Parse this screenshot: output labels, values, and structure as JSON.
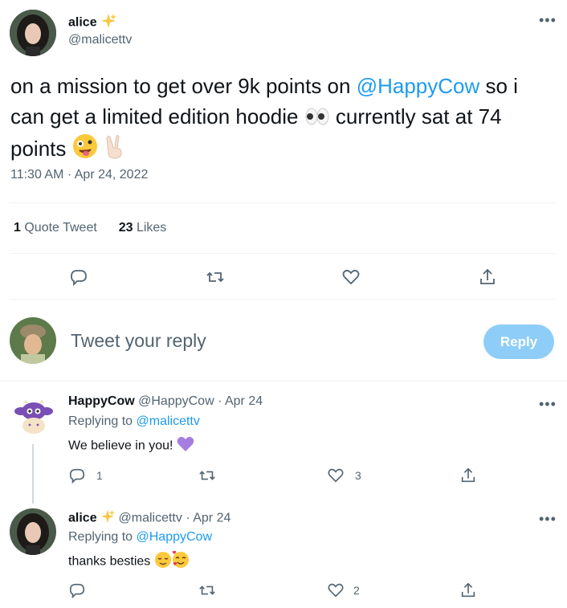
{
  "main_tweet": {
    "display_name": "alice",
    "handle": "@malicettv",
    "text_before": "on a mission to get over 9k points on ",
    "mention": "@HappyCow",
    "text_mid": " so i can get a limited edition hoodie ",
    "text_after": " currently sat at 74 points ",
    "timestamp": "11:30 AM · Apr 24, 2022",
    "quote_count": "1",
    "quote_label": "Quote Tweet",
    "like_count": "23",
    "like_label": "Likes"
  },
  "reply_box": {
    "placeholder": "Tweet your reply",
    "button_label": "Reply"
  },
  "replies": [
    {
      "display_name": "HappyCow",
      "handle": "@HappyCow",
      "date": "· Apr 24",
      "replying_prefix": "Replying to ",
      "replying_to": "@malicettv",
      "text": "We believe in you! ",
      "reply_count": "1",
      "like_count": "3"
    },
    {
      "display_name": "alice",
      "handle": "@malicettv",
      "date": "· Apr 24",
      "replying_prefix": "Replying to ",
      "replying_to": "@HappyCow",
      "text": "thanks besties ",
      "reply_count": "",
      "like_count": "2"
    }
  ],
  "colors": {
    "link": "#1d9bf0",
    "muted": "#536471",
    "reply_button": "#8ecdf8",
    "heart": "#a67de0"
  },
  "icons": [
    "sparkles-icon",
    "more-icon",
    "eyes-icon",
    "zany-face-icon",
    "victory-hand-icon",
    "reply-icon",
    "retweet-icon",
    "like-icon",
    "share-icon",
    "purple-heart-icon",
    "relieved-face-icon",
    "smiling-face-hearts-icon"
  ]
}
